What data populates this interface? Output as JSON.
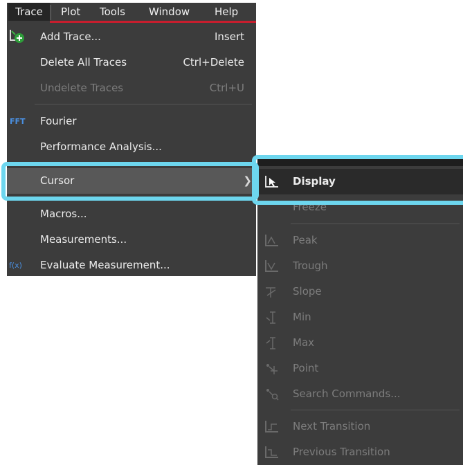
{
  "menubar": {
    "items": [
      "Trace",
      "Plot",
      "Tools",
      "Window",
      "Help"
    ]
  },
  "main_menu": {
    "items": [
      {
        "label": "Add Trace...",
        "shortcut": "Insert",
        "icon": "add-trace-icon",
        "enabled": true
      },
      {
        "label": "Delete All Traces",
        "shortcut": "Ctrl+Delete",
        "enabled": true
      },
      {
        "label": "Undelete Traces",
        "shortcut": "Ctrl+U",
        "enabled": false
      },
      {
        "label": "Fourier",
        "icon_text": "FFT",
        "enabled": true
      },
      {
        "label": "Performance Analysis...",
        "enabled": true
      },
      {
        "label": "Cursor",
        "enabled": true,
        "highlighted": true
      },
      {
        "label": "Macros...",
        "enabled": true
      },
      {
        "label": "Measurements...",
        "enabled": true
      },
      {
        "label": "Evaluate Measurement...",
        "icon_text": "f(x)",
        "enabled": true
      }
    ]
  },
  "cursor_submenu": {
    "items": [
      {
        "label": "Display",
        "icon": "cursor-display-icon",
        "enabled": true,
        "highlighted": true
      },
      {
        "label": "Freeze",
        "enabled": false
      },
      {
        "label": "Peak",
        "icon": "peak-icon",
        "enabled": false
      },
      {
        "label": "Trough",
        "icon": "trough-icon",
        "enabled": false
      },
      {
        "label": "Slope",
        "icon": "slope-icon",
        "enabled": false
      },
      {
        "label": "Min",
        "icon": "min-icon",
        "enabled": false
      },
      {
        "label": "Max",
        "icon": "max-icon",
        "enabled": false
      },
      {
        "label": "Point",
        "icon": "point-icon",
        "enabled": false
      },
      {
        "label": "Search Commands...",
        "icon": "search-commands-icon",
        "enabled": false
      },
      {
        "label": "Next Transition",
        "icon": "next-transition-icon",
        "enabled": false
      },
      {
        "label": "Previous Transition",
        "icon": "previous-transition-icon",
        "enabled": false
      }
    ]
  },
  "colors": {
    "menu_bg": "#3c3c3c",
    "highlight_outline": "#6dd6ee",
    "menubar_underline": "#c81e2e",
    "icon_blue": "#4a8fe0"
  }
}
